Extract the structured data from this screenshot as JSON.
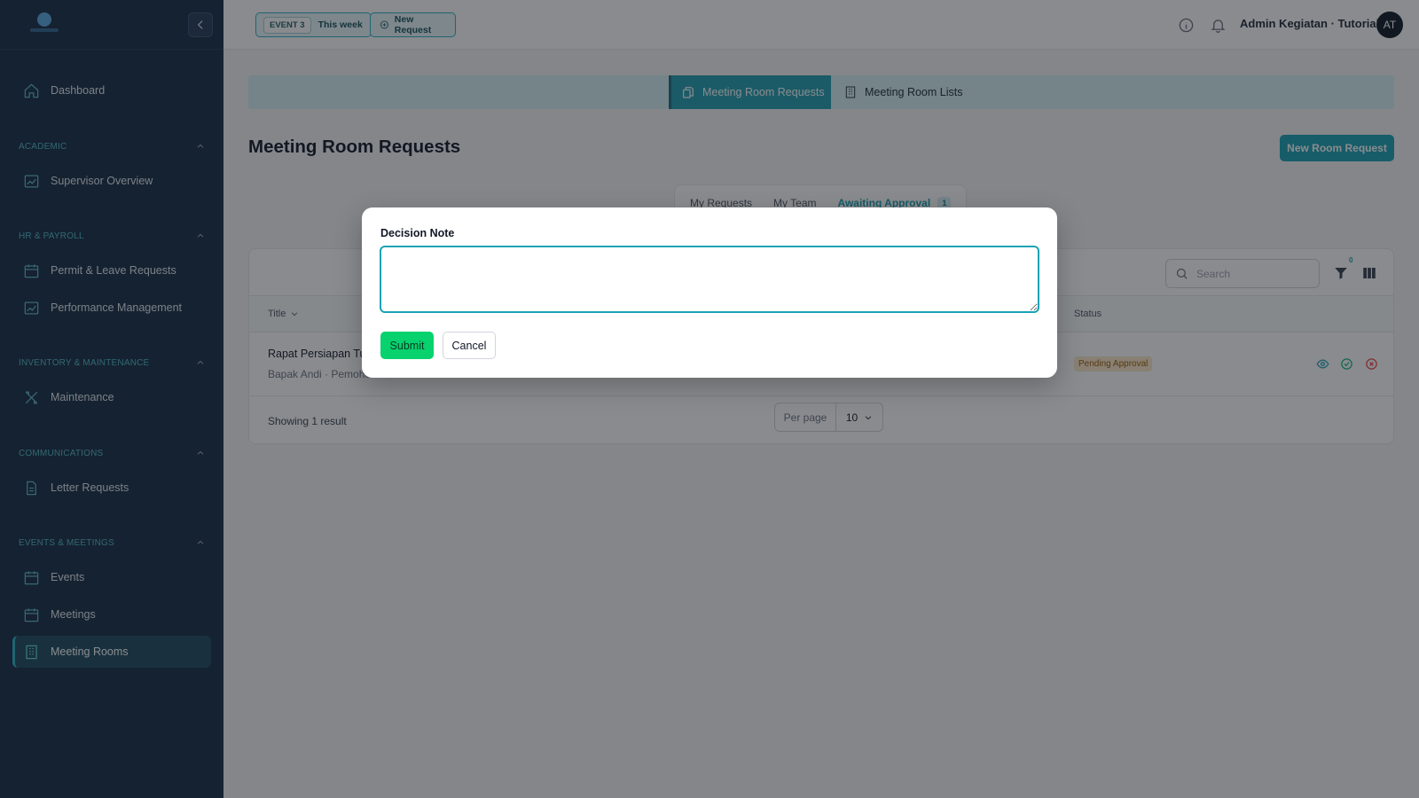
{
  "sidebar": {
    "items": {
      "dashboard": "Dashboard",
      "supervisor_overview": "Supervisor Overview",
      "permit_leave": "Permit & Leave Requests",
      "performance": "Performance Management",
      "maintenance": "Maintenance",
      "letter_requests": "Letter Requests",
      "events": "Events",
      "meetings": "Meetings",
      "meeting_rooms": "Meeting Rooms"
    },
    "sections": {
      "academic": "ACADEMIC",
      "hr_payroll": "HR & PAYROLL",
      "inventory": "INVENTORY & MAINTENANCE",
      "communications": "COMMUNICATIONS",
      "events_meetings": "EVENTS & MEETINGS"
    }
  },
  "header": {
    "event_badge": "EVENT 3",
    "event_label": "This week",
    "new_request": "New Request",
    "user_name": "Admin Kegiatan · Tutorial",
    "avatar_initials": "AT"
  },
  "main": {
    "tabs": {
      "requests": "Meeting Room Requests",
      "lists": "Meeting Room Lists"
    },
    "page_title": "Meeting Room Requests",
    "new_room_request": "New Room Request",
    "subtabs": {
      "my_requests": "My Requests",
      "my_team": "My Team",
      "awaiting_approval": "Awaiting Approval",
      "awaiting_count": "1"
    },
    "search_placeholder": "Search",
    "filter_count": "0",
    "table": {
      "columns": {
        "title": "Title",
        "status": "Status"
      },
      "rows": [
        {
          "title": "Rapat Persiapan Tutorial",
          "subtitle": "Bapak Andi · Pemohon Tutorial",
          "status": "Pending Approval"
        }
      ]
    },
    "footer": {
      "showing": "Showing 1 result",
      "per_page_label": "Per page",
      "per_page_value": "10"
    }
  },
  "modal": {
    "label": "Decision Note",
    "textarea_value": "",
    "submit": "Submit",
    "cancel": "Cancel"
  },
  "colors": {
    "sidebar_bg": "#172c44",
    "accent": "#1aa3b4",
    "submit_green": "#07d26e",
    "pending_badge": "#fde9c8"
  }
}
